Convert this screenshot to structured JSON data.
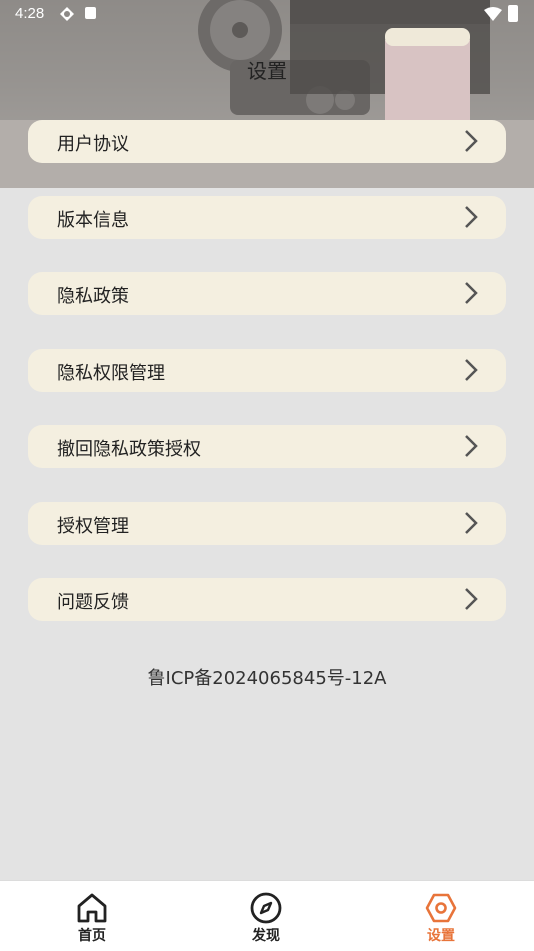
{
  "status_bar": {
    "time": "4:28"
  },
  "header": {
    "title": "设置"
  },
  "menu": {
    "items": [
      {
        "label": "用户协议"
      },
      {
        "label": "版本信息"
      },
      {
        "label": "隐私政策"
      },
      {
        "label": "隐私权限管理"
      },
      {
        "label": "撤回隐私政策授权"
      },
      {
        "label": "授权管理"
      },
      {
        "label": "问题反馈"
      }
    ]
  },
  "icp": "鲁ICP备2024065845号-12A",
  "tabbar": {
    "tabs": [
      {
        "label": "首页",
        "icon": "home-icon"
      },
      {
        "label": "发现",
        "icon": "compass-icon"
      },
      {
        "label": "设置",
        "icon": "settings-hexagon-icon",
        "active": true
      }
    ]
  },
  "colors": {
    "accent": "#e8743a",
    "card": "#f4efe0",
    "page": "#e3e3e3"
  }
}
